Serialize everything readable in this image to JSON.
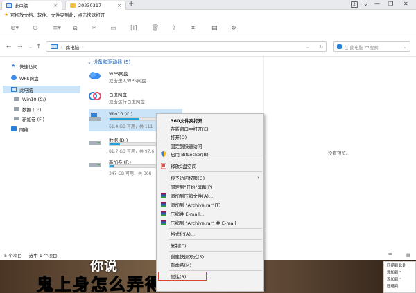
{
  "tabs": [
    {
      "label": "此电脑",
      "close": "×"
    },
    {
      "label": "20230317",
      "close": "×"
    }
  ],
  "tab_plus": "+",
  "tab_count": "2",
  "window_controls": [
    "⌄",
    "—",
    "❐",
    "✕"
  ],
  "notice": "可拖放文档、软件、文件夹到此，点击快速打开",
  "toolbar_icons": [
    "new-icon",
    "history-icon",
    "view-icon",
    "copy-icon",
    "cut-icon",
    "rename-icon",
    "delete-icon",
    "crop-icon",
    "properties-icon",
    "refresh-icon"
  ],
  "address": {
    "back": "←",
    "forward": "→",
    "up": "↑",
    "path": "此电脑",
    "chevron": "›",
    "dropdown": "⌄",
    "refresh": "↻"
  },
  "search": {
    "placeholder": "在 此电脑 中搜索"
  },
  "sidebar": {
    "items": [
      {
        "label": "快速访问"
      },
      {
        "label": "WPS网盘"
      },
      {
        "label": "此电脑"
      },
      {
        "label": "Win10 (C:)"
      },
      {
        "label": "数据 (D:)"
      },
      {
        "label": "新加卷 (F:)"
      },
      {
        "label": "网络"
      }
    ]
  },
  "main": {
    "section": "设备和驱动器 (5)",
    "items": [
      {
        "name": "WPS网盘",
        "sub": "双击进入WPS网盘"
      },
      {
        "name": "百度网盘",
        "sub": "双击运行百度网盘"
      }
    ],
    "drives": [
      {
        "name": "Win10 (C:)",
        "size": "61.4 GB 可用，共 111",
        "fill": 0.45
      },
      {
        "name": "数据 (D:)",
        "size": "81.7 GB 可用，共 97.6",
        "fill": 0.16
      },
      {
        "name": "新加卷 (F:)",
        "size": "347 GB 可用，共 368",
        "fill": 0.06
      }
    ]
  },
  "preview": {
    "empty": "没有预览。"
  },
  "status": {
    "count": "5 个项目",
    "selected": "选中 1 个项目"
  },
  "context_menu": {
    "items": [
      "360文件夹打开",
      "在新窗口中打开(E)",
      "打开(O)",
      "固定到快速访问",
      "启用 BitLocker(B)",
      "释放C盘空间",
      "授予访问权限(G)",
      "固定到\"开始\"屏幕(P)",
      "添加到压缩文件(A)...",
      "添加到 \"Archive.rar\"(T)",
      "压缩并 E-mail...",
      "压缩到 \"Archive.rar\" 并 E-mail",
      "格式化(A)...",
      "复制(C)",
      "创建快捷方式(S)",
      "重命名(M)",
      "属性(R)"
    ]
  },
  "video_subtitles": {
    "line1": "你说",
    "line2": "鬼上身怎么弄得"
  },
  "mini_panel": [
    "压缩到此处",
    "添加到 \"",
    "添加到 \"",
    "压缩到"
  ],
  "colors": {
    "accent": "#26a0da",
    "selection": "#cce4f7",
    "highlight_box": "#e0452f"
  }
}
